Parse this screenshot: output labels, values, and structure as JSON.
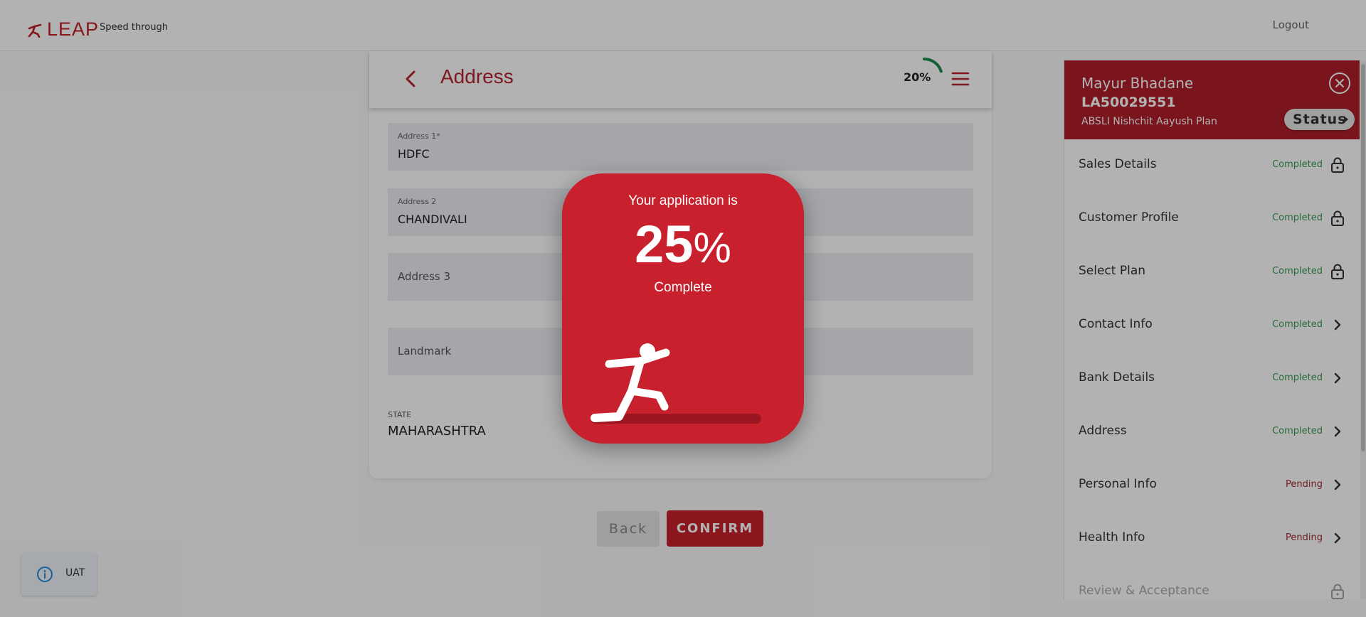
{
  "header": {
    "logo_text": "LEAP",
    "tagline": "Speed through",
    "logout_label": "Logout"
  },
  "page": {
    "title": "Address",
    "progress_text": "20%",
    "progress_value": 0.2
  },
  "form": {
    "address1": {
      "label": "Address 1*",
      "value": "HDFC"
    },
    "address2": {
      "label": "Address 2",
      "value": "CHANDIVALI"
    },
    "address3": {
      "placeholder": "Address 3"
    },
    "landmark": {
      "placeholder": "Landmark"
    },
    "state": {
      "label": "STATE",
      "value": "MAHARASHTRA"
    }
  },
  "actions": {
    "back_label": "Back",
    "confirm_label": "CONFIRM"
  },
  "env_badge": {
    "label": "UAT"
  },
  "panel": {
    "customer_name": "Mayur Bhadane",
    "application_id": "LA50029551",
    "plan": "ABSLI Nishchit Aayush Plan",
    "status_label": "Status",
    "steps": [
      {
        "label": "Sales Details",
        "status": "Completed",
        "icon": "lock-icon"
      },
      {
        "label": "Customer Profile",
        "status": "Completed",
        "icon": "lock-icon"
      },
      {
        "label": "Select Plan",
        "status": "Completed",
        "icon": "lock-icon"
      },
      {
        "label": "Contact Info",
        "status": "Completed",
        "icon": "chevron-right-icon"
      },
      {
        "label": "Bank Details",
        "status": "Completed",
        "icon": "chevron-right-icon"
      },
      {
        "label": "Address",
        "status": "Completed",
        "icon": "chevron-right-icon"
      },
      {
        "label": "Personal Info",
        "status": "Pending",
        "icon": "chevron-right-icon"
      },
      {
        "label": "Health Info",
        "status": "Pending",
        "icon": "chevron-right-icon"
      },
      {
        "label": "Review & Acceptance",
        "status": "",
        "icon": "lock-icon"
      }
    ]
  },
  "modal": {
    "line1": "Your application is",
    "percent": "25",
    "percent_sign": "%",
    "line3": "Complete"
  },
  "colors": {
    "brand_red": "#c8202c",
    "panel_red": "#b01f2a",
    "completed_green": "#3a9a55",
    "pending_red": "#9e2a35"
  }
}
